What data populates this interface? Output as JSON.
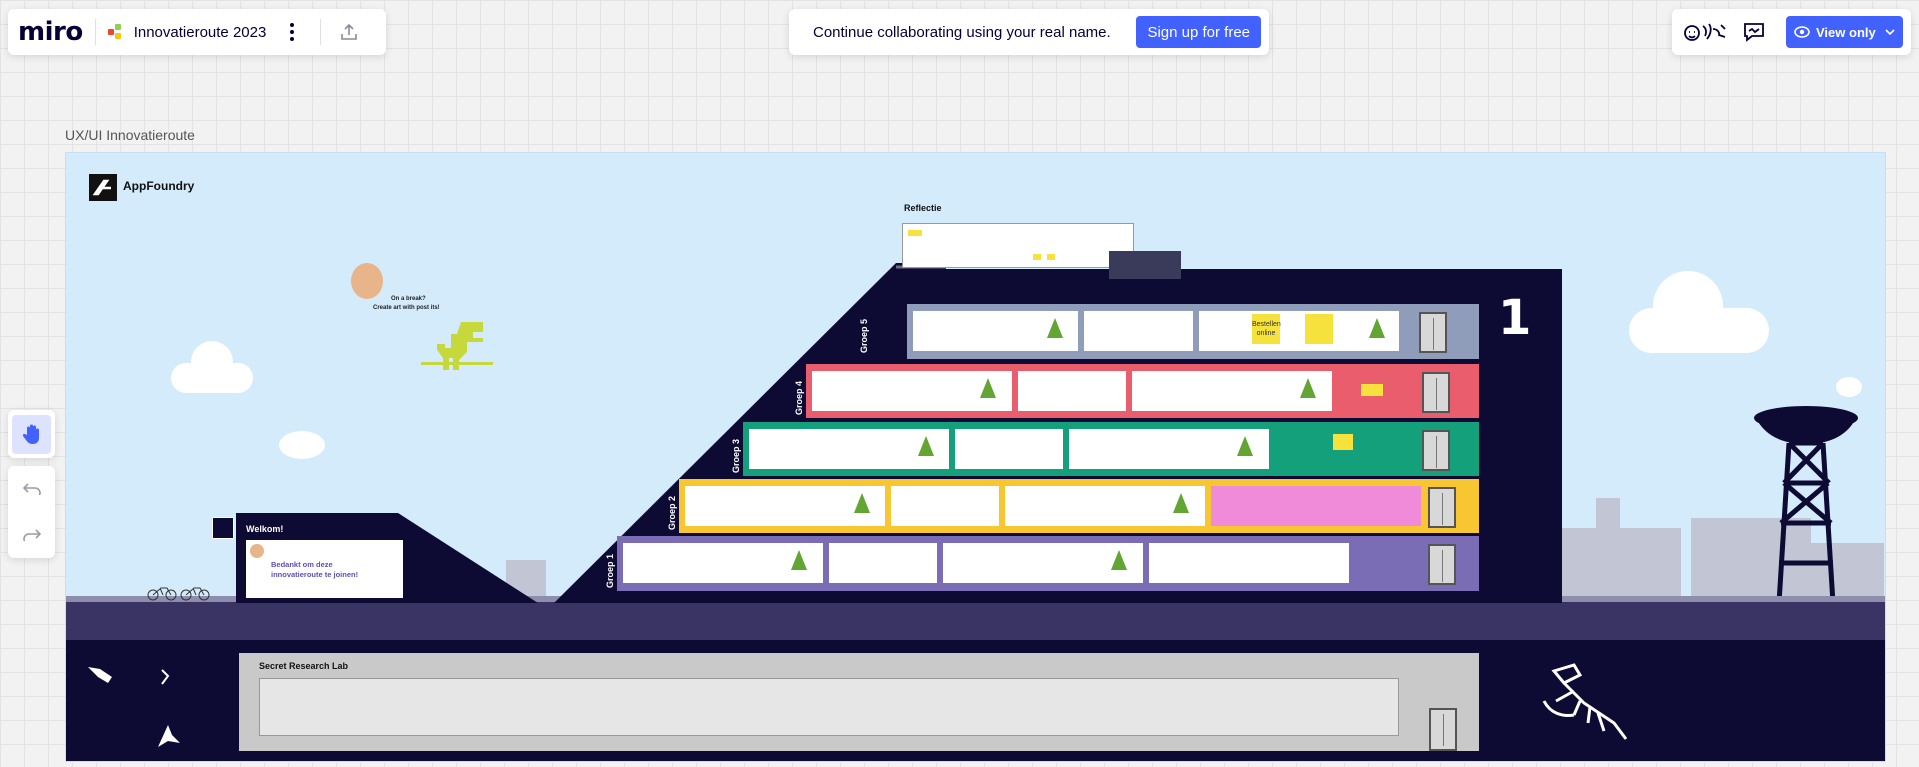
{
  "app": {
    "logo": "miro",
    "board_name": "Innovatieroute 2023"
  },
  "banner": {
    "text": "Continue collaborating using your real name.",
    "signup_label": "Sign up for free"
  },
  "header_right": {
    "view_only_label": "View only"
  },
  "frame": {
    "title": "UX/UI Innovatieroute",
    "brand": "AppFoundry",
    "reflection_label": "Reflectie",
    "floor_number": "1",
    "groups": [
      "Groep 5",
      "Groep 4",
      "Groep 3",
      "Groep 2",
      "Groep 1"
    ],
    "break_text_1": "On a break?",
    "break_text_2": "Create art with post its!",
    "welcome_title": "Welkom!",
    "welcome_text_1": "Bedankt om deze",
    "welcome_text_2": "innovatieroute te joinen!",
    "lab_label": "Secret Research Lab",
    "sticky_text_1": "Bestellen",
    "sticky_text_2": "online"
  },
  "colors": {
    "accent": "#4262ff",
    "sky": "#d4ebfb",
    "building": "#0d0a33",
    "groep5": "#8f9cba",
    "groep4": "#ea5d6c",
    "groep3": "#13a07a",
    "groep2": "#f7c631",
    "groep1": "#7a6db5"
  }
}
